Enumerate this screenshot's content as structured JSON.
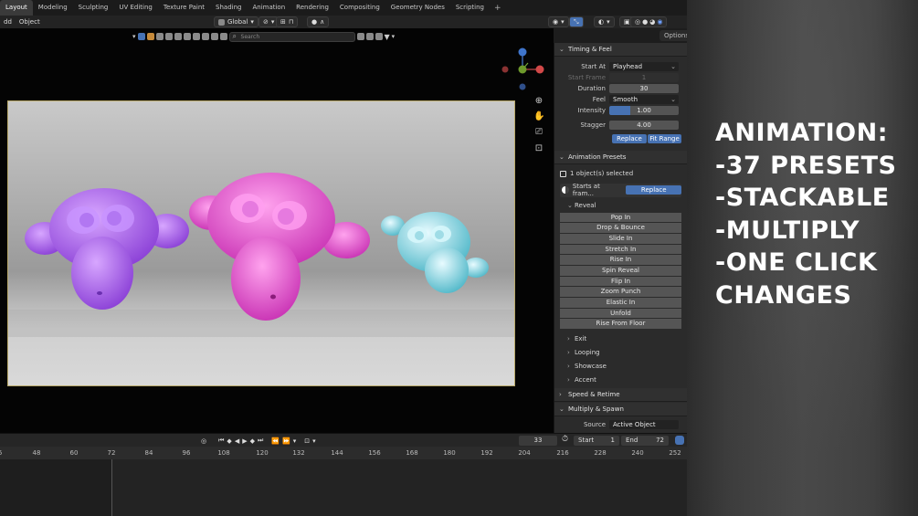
{
  "workspace_tabs": [
    {
      "label": "Layout",
      "active": true
    },
    {
      "label": "Modeling"
    },
    {
      "label": "Sculpting"
    },
    {
      "label": "UV Editing"
    },
    {
      "label": "Texture Paint"
    },
    {
      "label": "Shading"
    },
    {
      "label": "Animation"
    },
    {
      "label": "Rendering"
    },
    {
      "label": "Compositing"
    },
    {
      "label": "Geometry Nodes"
    },
    {
      "label": "Scripting"
    }
  ],
  "add_tab_label": "+",
  "header": {
    "menu_add": "dd",
    "menu_object": "Object",
    "transform_orientation": "Global",
    "options_label": "Options"
  },
  "viewport": {
    "search_placeholder": "Search"
  },
  "panel": {
    "timing": {
      "title": "Timing & Feel",
      "start_at_label": "Start At",
      "start_at_value": "Playhead",
      "start_frame_label": "Start Frame",
      "start_frame_value": "1",
      "duration_label": "Duration",
      "duration_value": "30",
      "feel_label": "Feel",
      "feel_value": "Smooth",
      "intensity_label": "Intensity",
      "intensity_value": "1.00",
      "intensity_fraction": 0.3,
      "stagger_label": "Stagger",
      "stagger_value": "4.00",
      "replace_label": "Replace",
      "fit_range_label": "Fit Range"
    },
    "presets": {
      "title": "Animation Presets",
      "selected_text": "1 object(s) selected",
      "starts_text": "Starts at fram...",
      "replace_label": "Replace",
      "reveal_label": "Reveal",
      "reveal_items": [
        "Pop In",
        "Drop & Bounce",
        "Slide In",
        "Stretch In",
        "Rise In",
        "Spin Reveal",
        "Flip In",
        "Zoom Punch",
        "Elastic In",
        "Unfold",
        "Rise From Floor"
      ],
      "collapsed_groups": [
        "Exit",
        "Looping",
        "Showcase",
        "Accent"
      ]
    },
    "speed_retime_title": "Speed & Retime",
    "multiply_title": "Multiply & Spawn",
    "source_label": "Source",
    "source_value": "Active Object"
  },
  "timeline": {
    "current_frame": "33",
    "start_label": "Start",
    "start_value": "1",
    "end_label": "End",
    "end_value": "72",
    "ruler_ticks": [
      "6",
      "48",
      "60",
      "72",
      "84",
      "96",
      "108",
      "120",
      "132",
      "144",
      "156",
      "168",
      "180",
      "192",
      "204",
      "216",
      "228",
      "240",
      "252"
    ]
  },
  "overlay": {
    "lines": [
      "Animation:",
      "-37 Presets",
      "-Stackable",
      "-Multiply",
      "-One Click",
      "Changes"
    ]
  },
  "colors": {
    "accent_blue": "#4772b3",
    "monkey_purple": "#b46cf0",
    "monkey_pink": "#f06ad6",
    "monkey_cyan": "#8fe0ea"
  }
}
